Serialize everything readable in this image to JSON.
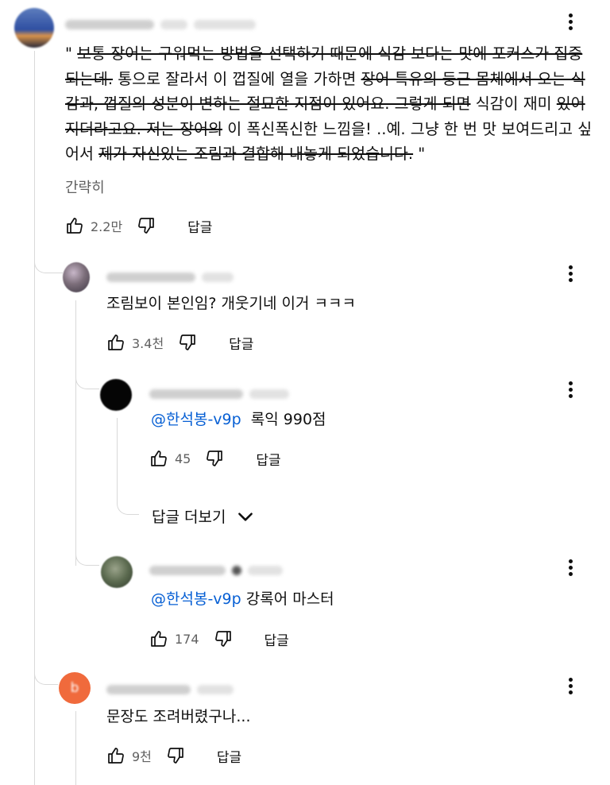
{
  "top_comment": {
    "segments": [
      {
        "text": "\" ",
        "strike": false
      },
      {
        "text": "보통 장어는 구워먹는 방법을 선택하기 때문에 식감 보다는 맛에 포커스가 집중되는데.",
        "strike": true
      },
      {
        "text": " 통으로 잘라서 이 껍질에 열을 가하면 ",
        "strike": false
      },
      {
        "text": "장어 특유의 둥근 몸체에서 오는 식감과, 껍질의 성분이 변하는 절묘한 지점이 있어요. 그렇게 되면",
        "strike": true
      },
      {
        "text": " 식감이 재미 ",
        "strike": false
      },
      {
        "text": "있어지더라고요. 저는 장어의",
        "strike": true
      },
      {
        "text": " 이 폭신폭신한 느낌을! ..예. 그냥 한 번 맛 보여드리고 싶어서 ",
        "strike": false
      },
      {
        "text": "제가 자신있는 조림과 결합해 내놓게 되었습니다.",
        "strike": true
      },
      {
        "text": " \"",
        "strike": false
      }
    ],
    "collapse_label": "간략히",
    "like_count": "2.2만",
    "reply_label": "답글"
  },
  "replies": [
    {
      "text": "조림보이 본인임? 개웃기네 이거 ㅋㅋㅋ",
      "like_count": "3.4천",
      "reply_label": "답글",
      "avatar_color": "#8a7f86"
    },
    {
      "mention": "@한석봉-v9p",
      "text": "록익 990점",
      "like_count": "45",
      "reply_label": "답글",
      "avatar_color": "#050505"
    },
    {
      "mention": "@한석봉-v9p",
      "text": " 강록어 마스터",
      "like_count": "174",
      "reply_label": "답글",
      "avatar_color": "#5b6a4f"
    },
    {
      "text": "문장도 조려버렸구나...",
      "like_count": "9천",
      "reply_label": "답글",
      "avatar_color": "#f06a3c"
    }
  ],
  "more_replies_label": "답글 더보기",
  "icons": {
    "like": "thumbs-up-icon",
    "dislike": "thumbs-down-icon",
    "menu": "more-vert-icon",
    "expand": "chevron-down-icon"
  }
}
